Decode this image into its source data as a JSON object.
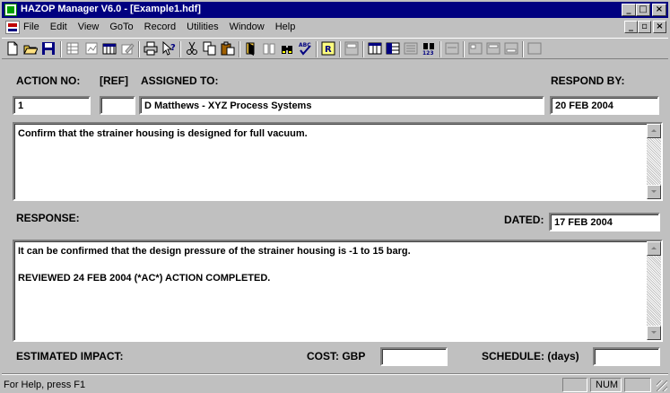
{
  "window": {
    "title": "HAZOP Manager V6.0 - [Example1.hdf]",
    "caption_buttons": [
      "_",
      "□",
      "×"
    ],
    "mdi_buttons": [
      "_",
      "▫",
      "×"
    ]
  },
  "menu": {
    "items": [
      "File",
      "Edit",
      "View",
      "GoTo",
      "Record",
      "Utilities",
      "Window",
      "Help"
    ]
  },
  "toolbar": {
    "icons": [
      "new-icon",
      "open-icon",
      "save-icon",
      "table-icon",
      "chart-icon",
      "grid-icon",
      "edit-icon",
      "print-icon",
      "help-pointer-icon",
      "cut-icon",
      "copy-icon",
      "paste-icon",
      "report-icon",
      "book-icon",
      "binoculars-icon",
      "spellcheck-icon",
      "navigator-icon",
      "report-alt-icon",
      "view-columns-icon",
      "view-alt-icon",
      "list-icon",
      "find-numbers-icon",
      "panel-1-icon",
      "panel-2-icon",
      "panel-3-icon",
      "panel-4-icon",
      "panel-5-icon"
    ]
  },
  "form": {
    "action_no_label": "ACTION NO:",
    "ref_label": "[REF]",
    "assigned_to_label": "ASSIGNED TO:",
    "respond_by_label": "RESPOND BY:",
    "action_no_value": "1",
    "ref_value": "",
    "assigned_to_value": "D Matthews - XYZ Process Systems",
    "respond_by_value": "20 FEB 2004",
    "action_text": "Confirm that the strainer housing is designed for full vacuum.",
    "response_label": "RESPONSE:",
    "dated_label": "DATED:",
    "dated_value": "17 FEB 2004",
    "response_text": "It can be confirmed that the design pressure of the strainer housing is -1 to 15 barg.\n\nREVIEWED 24 FEB 2004 (*AC*) ACTION COMPLETED.",
    "estimated_impact_label": "ESTIMATED IMPACT:",
    "cost_label": "COST:  GBP",
    "cost_value": "",
    "schedule_label": "SCHEDULE:  (days)",
    "schedule_value": ""
  },
  "status": {
    "help_text": "For Help, press F1",
    "num_indicator": "NUM"
  }
}
